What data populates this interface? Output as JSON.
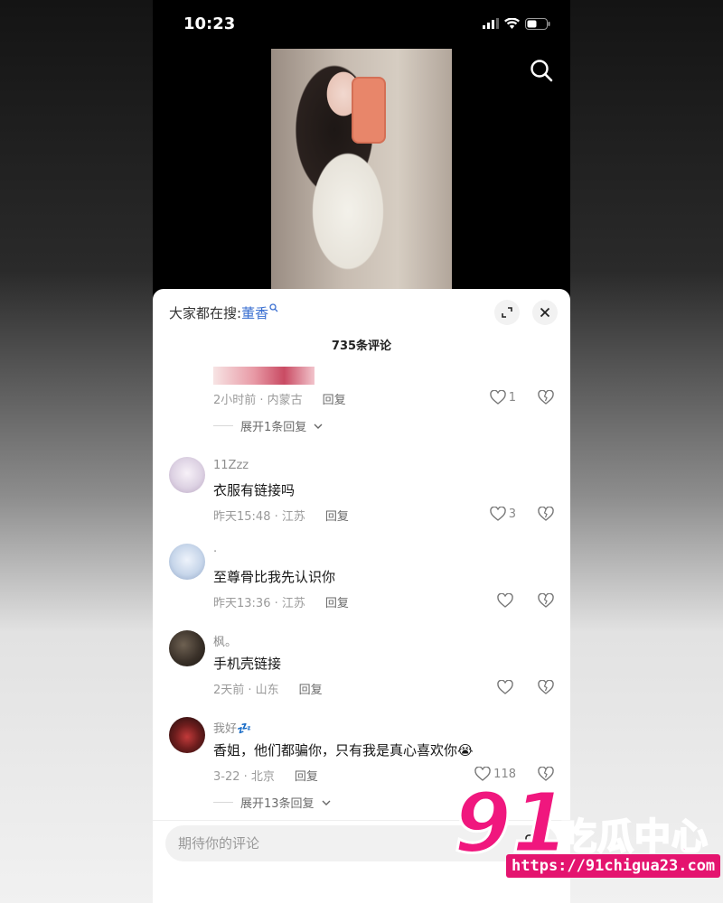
{
  "status": {
    "time": "10:23"
  },
  "sheet": {
    "search_prefix": "大家都在搜:",
    "search_term": "董香",
    "comment_count": "735条评论"
  },
  "comments": [
    {
      "user": "",
      "text": "",
      "time": "2小时前 · 内蒙古",
      "reply": "回复",
      "likes": "1",
      "expand": "展开1条回复"
    },
    {
      "user": "11Zzz",
      "text": "衣服有链接吗",
      "time": "昨天15:48 · 江苏",
      "reply": "回复",
      "likes": "3"
    },
    {
      "user": "·",
      "text": "至尊骨比我先认识你",
      "time": "昨天13:36 · 江苏",
      "reply": "回复",
      "likes": ""
    },
    {
      "user": "枫。",
      "text": "手机壳链接",
      "time": "2天前 · 山东",
      "reply": "回复",
      "likes": ""
    },
    {
      "user": "我好",
      "user_suffix": "💤",
      "text": "香姐，他们都骗你，只有我是真心喜欢你😭",
      "time": "3-22 · 北京",
      "reply": "回复",
      "likes": "118",
      "expand": "展开13条回复"
    }
  ],
  "input": {
    "placeholder": "期待你的评论"
  },
  "watermark": {
    "big": "91",
    "cn": "吃瓜中心",
    "url": "https://91chigua23.com"
  },
  "colors": {
    "accent_blue": "#3a6fd1",
    "watermark_pink": "#f0177e"
  }
}
